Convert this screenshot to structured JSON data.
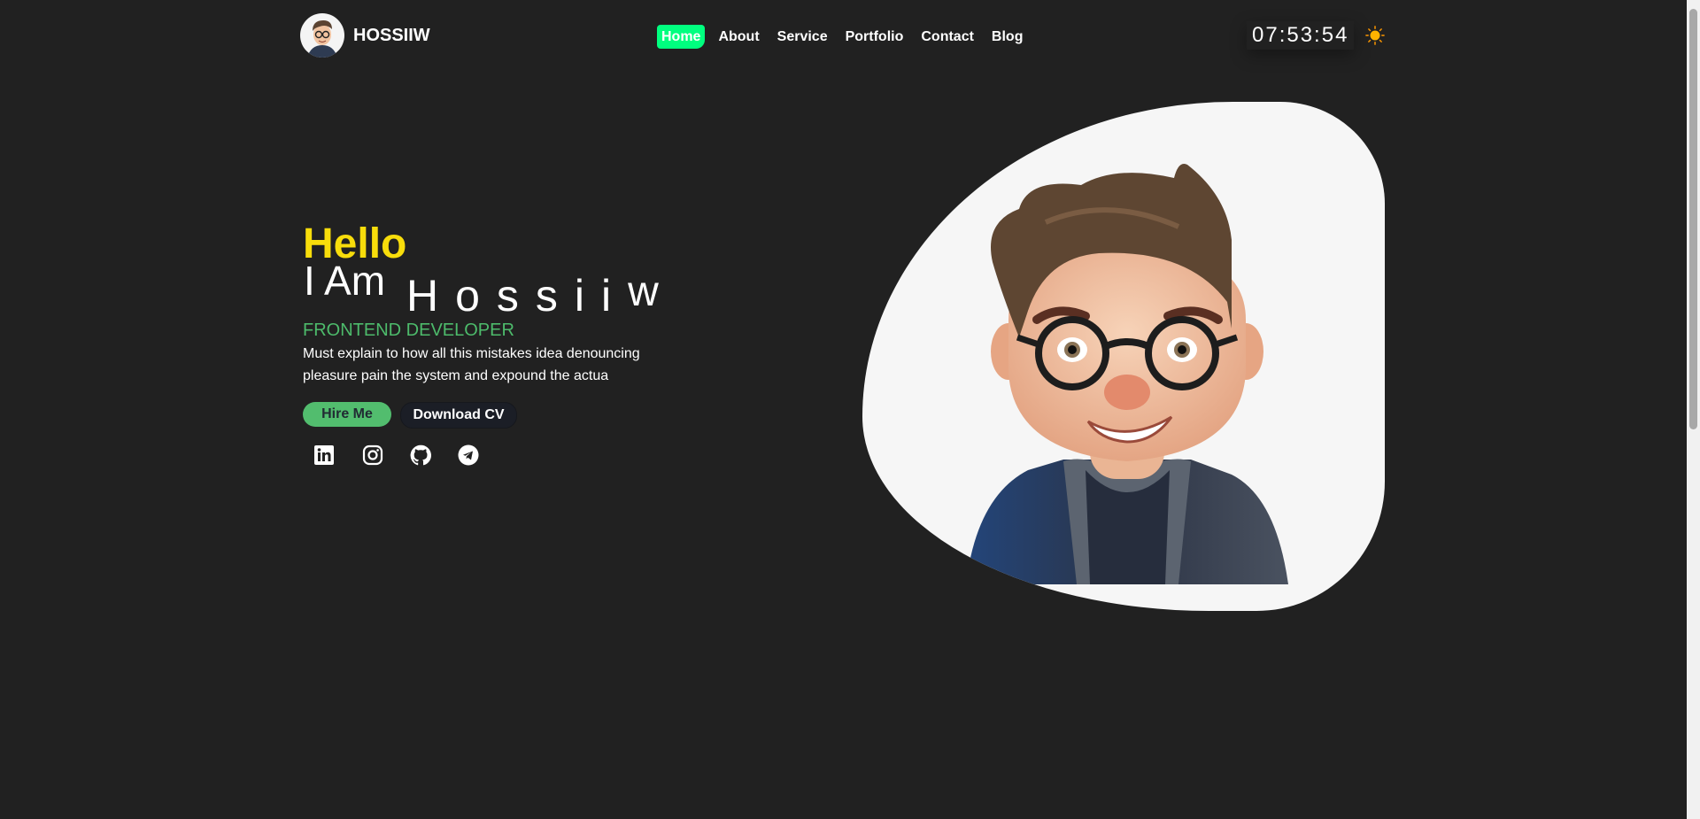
{
  "header": {
    "brand": "HOSSIIW",
    "nav": [
      {
        "label": "Home",
        "active": true
      },
      {
        "label": "About"
      },
      {
        "label": "Service"
      },
      {
        "label": "Portfolio"
      },
      {
        "label": "Contact"
      },
      {
        "label": "Blog"
      }
    ],
    "clock": "07:53:54",
    "theme_icon": "sun-icon"
  },
  "hero": {
    "greeting": "Hello",
    "intro": "I Am",
    "name_main": "Hossii",
    "name_last": "w",
    "role": "FRONTEND DEVELOPER",
    "description": "Must explain to how all this mistakes idea denouncing pleasure pain the system and expound the actua",
    "hire_label": "Hire Me",
    "cv_label": "Download CV",
    "socials": [
      "linkedin-icon",
      "instagram-icon",
      "github-icon",
      "telegram-icon"
    ]
  },
  "colors": {
    "background": "#212121",
    "accent_nav": "#00ff7f",
    "greeting": "#f8dd0b",
    "role": "#4dbb6b",
    "hire_button": "#52bd6e",
    "sun": "#ffb300"
  }
}
